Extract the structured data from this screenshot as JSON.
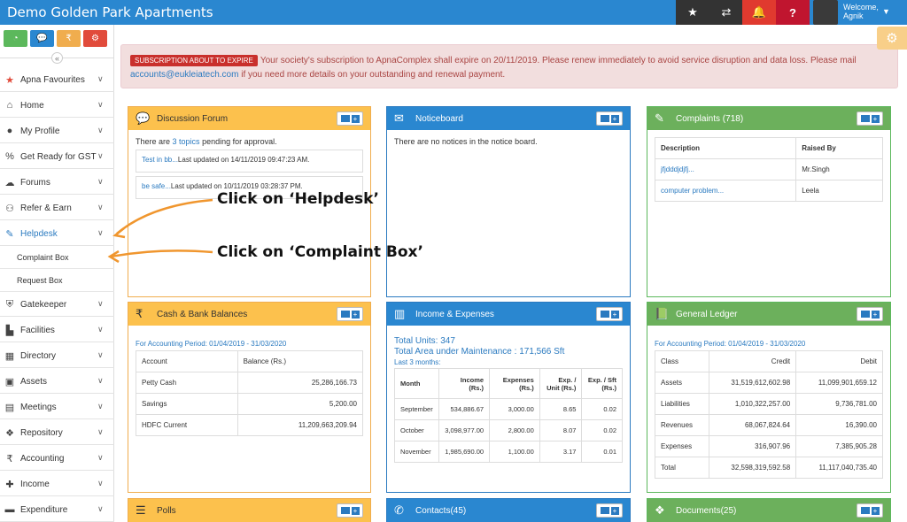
{
  "app": {
    "title": "Demo Golden Park Apartments"
  },
  "topbar": {
    "icons": [
      "star-icon",
      "shuffle-icon",
      "bell-icon",
      "help-icon"
    ],
    "welcome": "Welcome,",
    "user": "Agnik"
  },
  "quick": [
    {
      "icon": "dashboard-icon",
      "color": "#5cb85c"
    },
    {
      "icon": "chat-icon",
      "color": "#2a87d0"
    },
    {
      "icon": "rupee-icon",
      "color": "#f0ad4e"
    },
    {
      "icon": "cogs-icon",
      "color": "#e14b3b"
    }
  ],
  "sidebar": {
    "collapse": "«",
    "items": [
      {
        "label": "Apna Favourites",
        "icon": "★"
      },
      {
        "label": "Home",
        "icon": "⌂"
      },
      {
        "label": "My Profile",
        "icon": "👤"
      },
      {
        "label": "Get Ready for GST",
        "icon": "%"
      },
      {
        "label": "Forums",
        "icon": "☁"
      },
      {
        "label": "Refer & Earn",
        "icon": "⚇"
      },
      {
        "label": "Helpdesk",
        "icon": "🔧"
      },
      {
        "label": "Gatekeeper",
        "icon": "⛨"
      },
      {
        "label": "Facilities",
        "icon": "▙"
      },
      {
        "label": "Directory",
        "icon": "▦"
      },
      {
        "label": "Assets",
        "icon": "▣"
      },
      {
        "label": "Meetings",
        "icon": "▤"
      },
      {
        "label": "Repository",
        "icon": "❖"
      },
      {
        "label": "Accounting",
        "icon": "₹"
      },
      {
        "label": "Income",
        "icon": "✚"
      },
      {
        "label": "Expenditure",
        "icon": "▬"
      }
    ],
    "sub": [
      "Complaint Box",
      "Request Box"
    ]
  },
  "alert": {
    "badge": "SUBSCRIPTION ABOUT TO EXPIRE",
    "text1": "Your society's subscription to ApnaComplex shall expire on 20/11/2019. Please renew immediately to avoid service disruption and data loss. Please mail ",
    "mail": "accounts@eukleiatech.com",
    "text2": " if you need more details on your outstanding and renewal payment."
  },
  "forum": {
    "title": "Discussion Forum",
    "pre": "There are ",
    "link": "3 topics",
    "post": " pending for approval.",
    "rows": [
      {
        "t": "Test in bb...",
        "d": "Last updated on 14/11/2019 09:47:23 AM."
      },
      {
        "t": "be safe...",
        "d": "Last updated on 10/11/2019 03:28:37 PM."
      }
    ]
  },
  "notice": {
    "title": "Noticeboard",
    "text": "There are no notices in the notice board."
  },
  "complaints": {
    "title": "Complaints (718)",
    "headers": [
      "Description",
      "Raised By"
    ],
    "rows": [
      [
        "jfjdddjdjfj...",
        "Mr.Singh"
      ],
      [
        "computer problem...",
        "Leela"
      ]
    ]
  },
  "cash": {
    "title": "Cash & Bank Balances",
    "period": "For Accounting Period: 01/04/2019 - 31/03/2020",
    "headers": [
      "Account",
      "Balance (Rs.)"
    ],
    "rows": [
      [
        "Petty Cash",
        "25,286,166.73"
      ],
      [
        "Savings",
        "5,200.00"
      ],
      [
        "HDFC Current",
        "11,209,663,209.94"
      ]
    ]
  },
  "income": {
    "title": "Income & Expenses",
    "units": "Total Units: 347",
    "area": "Total Area under Maintenance : 171,566 Sft",
    "last": "Last 3 months:",
    "headers": [
      "Month",
      "Income (Rs.)",
      "Expenses (Rs.)",
      "Exp. / Unit (Rs.)",
      "Exp. / Sft (Rs.)"
    ],
    "rows": [
      [
        "September",
        "534,886.67",
        "3,000.00",
        "8.65",
        "0.02"
      ],
      [
        "October",
        "3,098,977.00",
        "2,800.00",
        "8.07",
        "0.02"
      ],
      [
        "November",
        "1,985,690.00",
        "1,100.00",
        "3.17",
        "0.01"
      ]
    ]
  },
  "ledger": {
    "title": "General Ledger",
    "period": "For Accounting Period: 01/04/2019 - 31/03/2020",
    "headers": [
      "Class",
      "Credit",
      "Debit"
    ],
    "rows": [
      [
        "Assets",
        "31,519,612,602.98",
        "11,099,901,659.12"
      ],
      [
        "Liabilities",
        "1,010,322,257.00",
        "9,736,781.00"
      ],
      [
        "Revenues",
        "68,067,824.64",
        "16,390.00"
      ],
      [
        "Expenses",
        "316,907.96",
        "7,385,905.28"
      ],
      [
        "Total",
        "32,598,319,592.58",
        "11,117,040,735.40"
      ]
    ]
  },
  "polls": {
    "title": "Polls"
  },
  "contacts": {
    "title": "Contacts(45)"
  },
  "documents": {
    "title": "Documents(25)"
  },
  "annotations": {
    "a1": "Click on ‘Helpdesk’",
    "a2": "Click on ‘Complaint Box’"
  }
}
